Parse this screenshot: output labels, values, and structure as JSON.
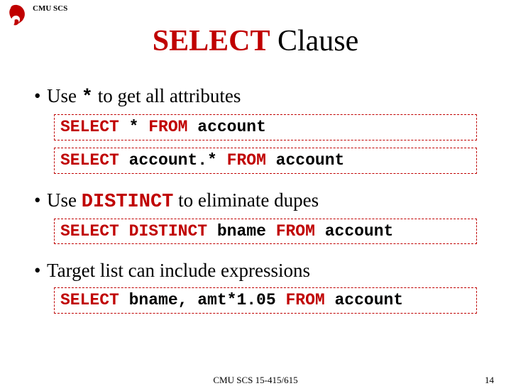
{
  "header": {
    "label": "CMU SCS"
  },
  "title": {
    "keyword": "SELECT",
    "rest": " Clause"
  },
  "bullets": {
    "b1_pre": "Use ",
    "b1_star": "*",
    "b1_post": " to get all attributes",
    "b2_pre": "Use ",
    "b2_kw": "DISTINCT",
    "b2_post": " to eliminate dupes",
    "b3": "Target list can include expressions"
  },
  "code": {
    "c1a": "SELECT",
    "c1b": " * ",
    "c1c": "FROM",
    "c1d": " account",
    "c2a": "SELECT",
    "c2b": " account.* ",
    "c2c": "FROM",
    "c2d": " account",
    "c3a": "SELECT",
    "c3b": " ",
    "c3c": "DISTINCT",
    "c3d": " bname ",
    "c3e": "FROM",
    "c3f": " account",
    "c4a": "SELECT",
    "c4b": " bname, amt*1.05 ",
    "c4c": "FROM",
    "c4d": " account"
  },
  "footer": {
    "center": "CMU SCS 15-415/615",
    "page": "14"
  },
  "colors": {
    "accent": "#c00000"
  }
}
